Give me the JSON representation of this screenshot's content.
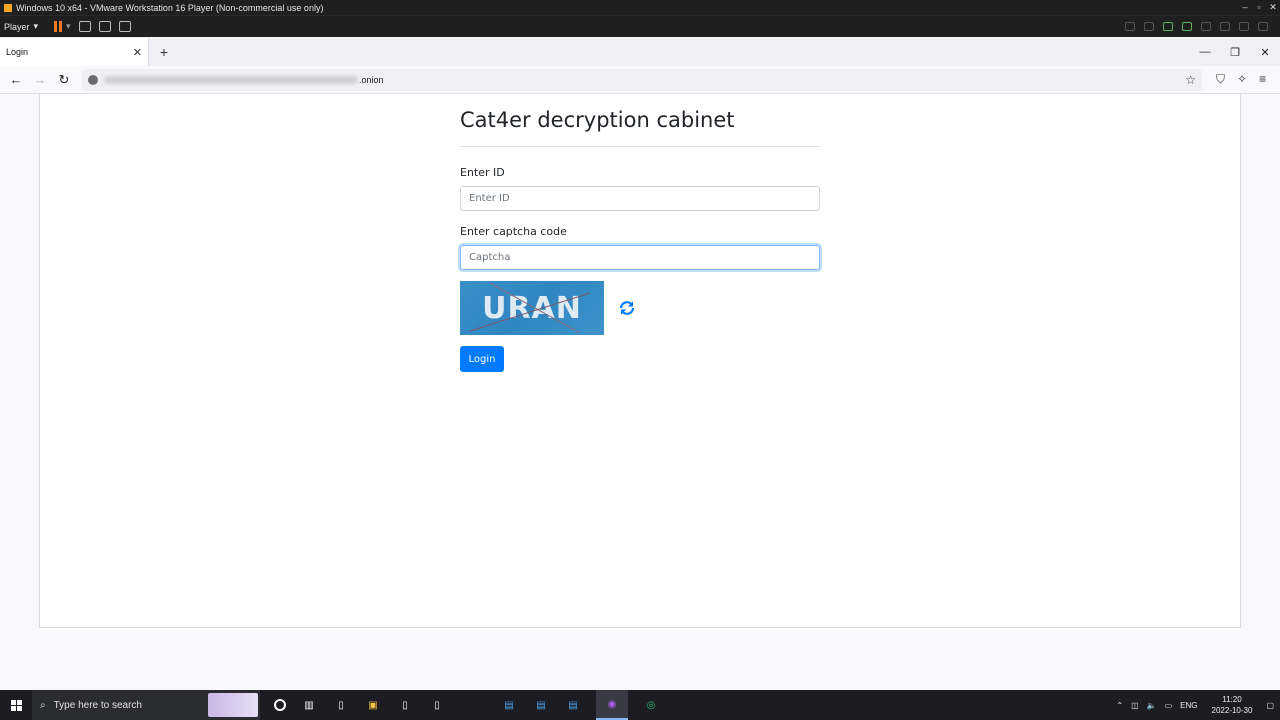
{
  "vm": {
    "title": "Windows 10 x64 - VMware Workstation 16 Player (Non-commercial use only)",
    "player_menu": "Player"
  },
  "browser": {
    "tab_title": "Login",
    "url_suffix": ".onion"
  },
  "page": {
    "title": "Cat4er decryption cabinet",
    "id_label": "Enter ID",
    "id_placeholder": "Enter ID",
    "captcha_label": "Enter captcha code",
    "captcha_placeholder": "Captcha",
    "captcha_text": "URAN",
    "login_button": "Login"
  },
  "taskbar": {
    "search_placeholder": "Type here to search",
    "language": "ENG",
    "time": "11:20",
    "date": "2022-10-30"
  },
  "colors": {
    "primary": "#007bff",
    "vm_bar": "#1f1f1f",
    "pause_orange": "#f27a24",
    "taskbar": "#1c1c22"
  },
  "icons": [
    "pause-icon",
    "refresh-icon",
    "back-icon",
    "forward-icon",
    "reload-icon",
    "bookmark-star-icon",
    "shield-icon",
    "extensions-icon",
    "menu-icon",
    "windows-start-icon",
    "search-icon"
  ]
}
